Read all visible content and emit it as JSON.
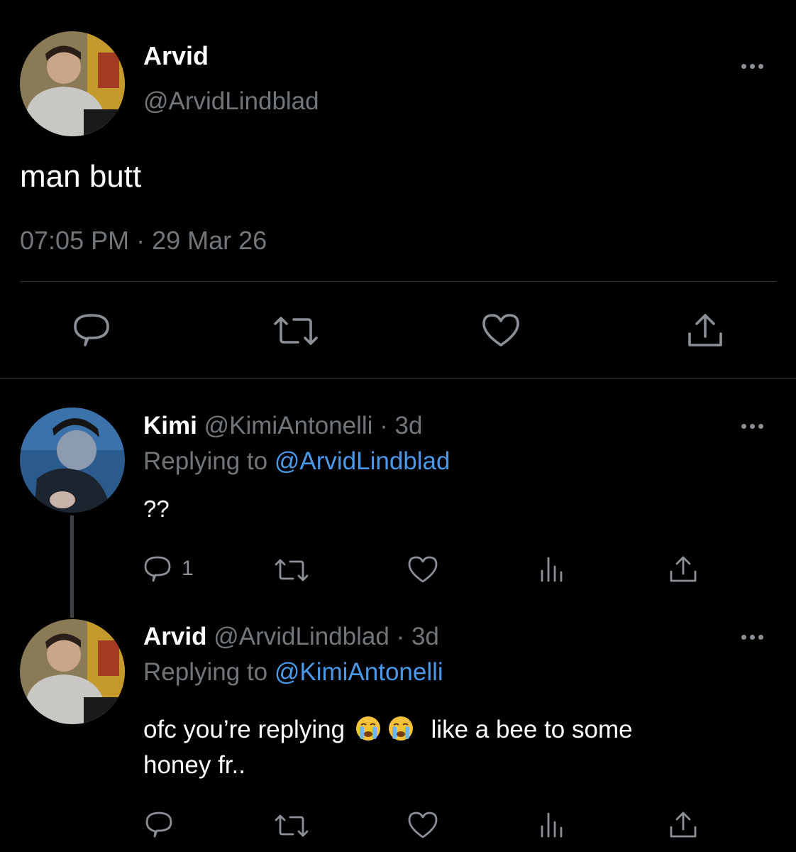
{
  "main_tweet": {
    "name": "Arvid",
    "handle": "@ArvidLindblad",
    "text": "man butt",
    "timestamp": "07:05 PM · 29 Mar 26"
  },
  "reply1": {
    "name": "Kimi",
    "handle": "@KimiAntonelli",
    "age": "· 3d",
    "replying_prefix": "Replying to",
    "replying_to": "@ArvidLindblad",
    "text": "??",
    "reply_count": "1"
  },
  "reply2": {
    "name": "Arvid",
    "handle": "@ArvidLindblad",
    "age": "· 3d",
    "replying_prefix": "Replying to",
    "replying_to": "@KimiAntonelli",
    "text_line1_a": "ofc you’re replying",
    "text_line1_b": "like a bee to some",
    "text_line2": "honey fr.."
  },
  "colors": {
    "background": "#000000",
    "muted": "#71767b",
    "link": "#4a99e9",
    "divider": "#2f3336"
  },
  "icons": [
    "more-icon",
    "reply-icon",
    "retweet-icon",
    "like-icon",
    "share-icon",
    "analytics-icon",
    "crying-face-emoji"
  ]
}
